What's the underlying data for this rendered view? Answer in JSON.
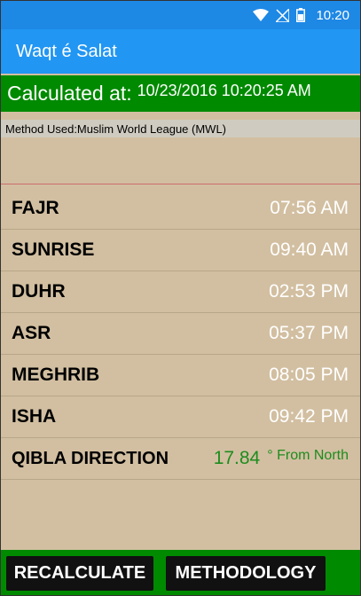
{
  "status_bar": {
    "time": "10:20",
    "icons": [
      "wifi-icon",
      "no-signal-icon",
      "battery-icon"
    ]
  },
  "app_bar": {
    "title": "Waqt é Salat"
  },
  "calculated": {
    "label": "Calculated at:",
    "value": "10/23/2016 10:20:25 AM"
  },
  "method": {
    "text": "Method Used:Muslim World League (MWL)"
  },
  "prayers": [
    {
      "name": "FAJR",
      "time": "07:56 AM"
    },
    {
      "name": "SUNRISE",
      "time": "09:40 AM"
    },
    {
      "name": "DUHR",
      "time": "02:53 PM"
    },
    {
      "name": "ASR",
      "time": "05:37 PM"
    },
    {
      "name": "MEGHRIB",
      "time": "08:05 PM"
    },
    {
      "name": "ISHA",
      "time": "09:42 PM"
    }
  ],
  "qibla": {
    "name": "QIBLA DIRECTION",
    "degrees": "17.84",
    "unit": "° From North"
  },
  "buttons": {
    "recalculate": "RECALCULATE",
    "methodology": "METHODOLOGY"
  },
  "colors": {
    "app_bar": "#2196f3",
    "status_bar": "#1e88e5",
    "green": "#008a00",
    "background": "#d2bfa1",
    "qibla_text": "#1e8c1e"
  }
}
